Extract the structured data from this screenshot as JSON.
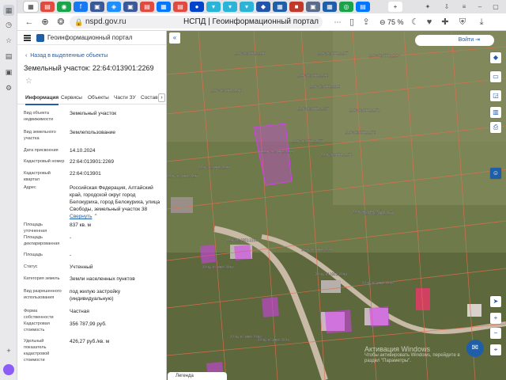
{
  "browser": {
    "url": "nspd.gov.ru",
    "page_title": "НСПД | Геоинформационный портал",
    "zoom": "75 %",
    "tabs": [
      {
        "glyph": "▦",
        "color": "#5b6b8c"
      },
      {
        "glyph": "▤",
        "color": "#e04a3f"
      },
      {
        "glyph": "◉",
        "color": "#1aa34a"
      },
      {
        "glyph": "f",
        "color": "#1877f2"
      },
      {
        "glyph": "▣",
        "color": "#3b5998"
      },
      {
        "glyph": "◈",
        "color": "#1f8fff"
      },
      {
        "glyph": "▣",
        "color": "#3b5998"
      },
      {
        "glyph": "▤",
        "color": "#e04a3f"
      },
      {
        "glyph": "▦",
        "color": "#0077ff"
      },
      {
        "glyph": "▤",
        "color": "#e04a3f"
      },
      {
        "glyph": "●",
        "color": "#0044cc"
      },
      {
        "glyph": "▾",
        "color": "#2bb3d8"
      },
      {
        "glyph": "▾",
        "color": "#2bb3d8"
      },
      {
        "glyph": "▾",
        "color": "#2bb3d8"
      },
      {
        "glyph": "◆",
        "color": "#2255aa"
      },
      {
        "glyph": "▦",
        "color": "#1f5ea8"
      },
      {
        "glyph": "■",
        "color": "#c0392b"
      },
      {
        "glyph": "▣",
        "color": "#5b6b8c"
      },
      {
        "glyph": "▦",
        "color": "#1f5ea8"
      },
      {
        "glyph": "◎",
        "color": "#1aa34a"
      },
      {
        "glyph": "▤",
        "color": "#0077ff"
      }
    ]
  },
  "portal": {
    "name": "Геоинформационный портал",
    "back_link": "Назад в выделенные объекты",
    "parcel_title": "Земельный участок: 22:64:013901:2269",
    "tabs": [
      "Информация",
      "Сервисы",
      "Объекты",
      "Части ЗУ",
      "Состав"
    ],
    "info": [
      {
        "label": "Вид объекта недвижимости",
        "value": "Земельный участок"
      },
      {
        "label": "Вид земельного участка",
        "value": "Землепользование"
      },
      {
        "label": "Дата присвоения",
        "value": "14.10.2024"
      },
      {
        "label": "Кадастровый номер",
        "value": "22:64:013901:2269"
      },
      {
        "label": "Кадастровый квартал",
        "value": "22:64:013901"
      },
      {
        "label": "Адрес",
        "value": "Российская Федерация, Алтайский край, городской округ город Белокуриха, город Белокуриха, улица Свободы, земельный участок 38",
        "more": "Свернуть"
      },
      {
        "label": "Площадь уточненная",
        "value": "837 кв. м"
      },
      {
        "label": "Площадь декларированная",
        "value": "-"
      },
      {
        "label": "Площадь",
        "value": "-"
      },
      {
        "label": "Статус",
        "value": "Учтенный"
      },
      {
        "label": "Категория земель",
        "value": "Земли населенных пунктов"
      },
      {
        "label": "Вид разрешенного использования",
        "value": "под жилую застройку (индивидуальную)"
      },
      {
        "label": "Форма собственности",
        "value": "Частная"
      },
      {
        "label": "Кадастровая стоимость",
        "value": "356 787,99 руб."
      },
      {
        "label": "Удельный показатель кадастровой стоимости",
        "value": "426,27 руб./кв. м"
      }
    ],
    "bottom_tab": "Легенда"
  },
  "map": {
    "login": "Войти",
    "windows_watermark": [
      "Активация Windows",
      "Чтобы активировать Windows, перейдите в",
      "раздел \"Параметры\"."
    ],
    "parcel_labels": [
      "22:64:013901:2196",
      "22:64:013901:2167",
      "22:64:013901:2194",
      "22:64:013901:2198",
      "22:64:013901:2185",
      "22:64:013901:2271",
      "22:64:013901:2199",
      "22:64:013901:2266",
      "22:64:013901:2269",
      "22:64:013901:2275",
      "22:64:013901:2178",
      "22:64:013901:2156",
      "22:64:013901:2179",
      "22:64:013901:2276",
      "22:64:013901:2190",
      "22:64:013901:2297",
      "22:64:013901:2196",
      "22:64:013901:2181",
      "22:64:013901:2267",
      "22:64:013901:2193",
      "22:64:013901:2288",
      "22:64:013901:2168",
      "22:64:013901:2227"
    ]
  },
  "colors": {
    "accent": "#1f5ea8",
    "parcel_highlight": "#d63cf0",
    "map_bg": "#6f7a4a"
  }
}
